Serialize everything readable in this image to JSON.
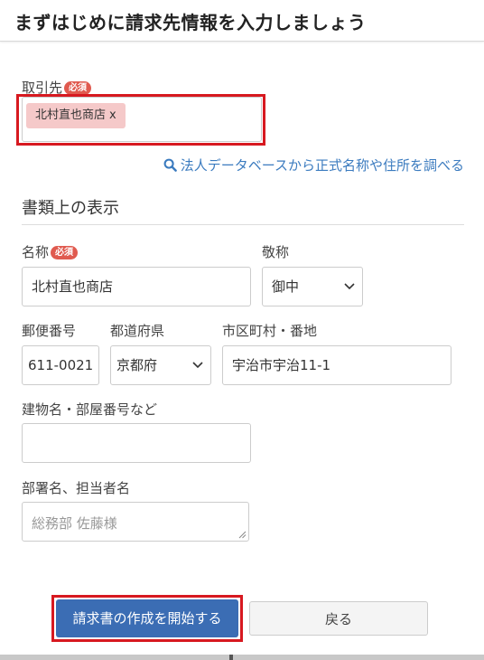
{
  "header": {
    "title": "まずはじめに請求先情報を入力しましょう"
  },
  "client": {
    "label": "取引先",
    "required_badge": "必須",
    "tag_text": "北村直也商店",
    "tag_remove": "x"
  },
  "lookup_link": {
    "icon": "search-icon",
    "text": "法人データベースから正式名称や住所を調べる"
  },
  "display_section": {
    "title": "書類上の表示",
    "name": {
      "label": "名称",
      "required_badge": "必須",
      "value": "北村直也商店"
    },
    "honorific": {
      "label": "敬称",
      "value": "御中"
    },
    "postal": {
      "label": "郵便番号",
      "value": "611-0021"
    },
    "prefecture": {
      "label": "都道府県",
      "value": "京都府"
    },
    "city": {
      "label": "市区町村・番地",
      "value": "宇治市宇治11-1"
    },
    "building": {
      "label": "建物名・部屋番号など",
      "value": ""
    },
    "department": {
      "label": "部署名、担当者名",
      "placeholder": "総務部 佐藤様"
    }
  },
  "actions": {
    "start_label": "請求書の作成を開始する",
    "back_label": "戻る"
  },
  "colors": {
    "accent": "#3b6db4",
    "link": "#3b7bbf",
    "badge": "#e05a4f",
    "tag_bg": "#f5c9c9",
    "highlight": "#d71920"
  }
}
